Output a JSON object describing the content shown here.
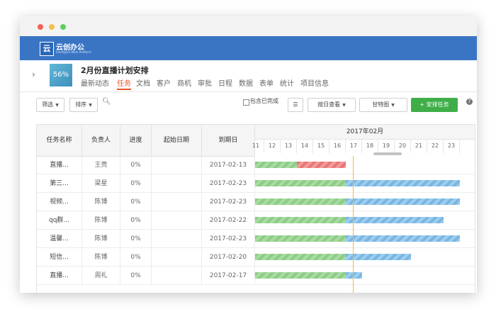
{
  "app": {
    "brand": "云创办公",
    "brand_sub": "Intelligent Work Platform",
    "logo_glyph": "云"
  },
  "project": {
    "title": "2月份直播计划安排",
    "progress": "56%"
  },
  "tabs": [
    {
      "label": "最新动态",
      "active": false
    },
    {
      "label": "任务",
      "active": true
    },
    {
      "label": "文档",
      "active": false
    },
    {
      "label": "客户",
      "active": false
    },
    {
      "label": "商机",
      "active": false
    },
    {
      "label": "审批",
      "active": false
    },
    {
      "label": "日程",
      "active": false
    },
    {
      "label": "数据",
      "active": false
    },
    {
      "label": "表单",
      "active": false
    },
    {
      "label": "统计",
      "active": false
    },
    {
      "label": "项目信息",
      "active": false
    }
  ],
  "toolbar": {
    "filter": "筛选",
    "sort": "排序",
    "include_done": "包含已完成",
    "view_by": "按日查看",
    "chart_type": "甘特图",
    "arrange": "+ 安排任务",
    "help": "?"
  },
  "table": {
    "headers": {
      "name": "任务名称",
      "owner": "负责人",
      "progress": "进度",
      "start": "起始日期",
      "due": "到期日"
    },
    "month": "2017年02月",
    "days": [
      "11",
      "12",
      "13",
      "14",
      "15",
      "16",
      "17",
      "18",
      "19",
      "20",
      "21",
      "22",
      "23"
    ],
    "rows": [
      {
        "name": "直播...",
        "owner": "王亮",
        "progress": "0%",
        "start": "",
        "due": "2017-02-13"
      },
      {
        "name": "第三...",
        "owner": "梁星",
        "progress": "0%",
        "start": "",
        "due": "2017-02-23"
      },
      {
        "name": "视频...",
        "owner": "陈博",
        "progress": "0%",
        "start": "",
        "due": "2017-02-23"
      },
      {
        "name": "qq群...",
        "owner": "陈博",
        "progress": "0%",
        "start": "",
        "due": "2017-02-22"
      },
      {
        "name": "温馨...",
        "owner": "陈博",
        "progress": "0%",
        "start": "",
        "due": "2017-02-23"
      },
      {
        "name": "短信...",
        "owner": "陈博",
        "progress": "0%",
        "start": "",
        "due": "2017-02-20"
      },
      {
        "name": "直播...",
        "owner": "周礼",
        "progress": "0%",
        "start": "",
        "due": "2017-02-17"
      }
    ]
  },
  "gantt": {
    "today": "17",
    "bars": [
      {
        "segments": [
          {
            "from": "11",
            "to": "13",
            "status": "done"
          },
          {
            "from": "14",
            "to": "16",
            "status": "overdue"
          }
        ]
      },
      {
        "segments": [
          {
            "from": "11",
            "to": "16",
            "status": "done"
          },
          {
            "from": "17",
            "to": "23",
            "status": "remaining"
          }
        ]
      },
      {
        "segments": [
          {
            "from": "11",
            "to": "16",
            "status": "done"
          },
          {
            "from": "17",
            "to": "23",
            "status": "remaining"
          }
        ]
      },
      {
        "segments": [
          {
            "from": "11",
            "to": "16",
            "status": "done"
          },
          {
            "from": "17",
            "to": "22",
            "status": "remaining"
          }
        ]
      },
      {
        "segments": [
          {
            "from": "11",
            "to": "16",
            "status": "done"
          },
          {
            "from": "17",
            "to": "23",
            "status": "remaining"
          }
        ]
      },
      {
        "segments": [
          {
            "from": "11",
            "to": "16",
            "status": "done"
          },
          {
            "from": "17",
            "to": "20",
            "status": "remaining"
          }
        ]
      },
      {
        "segments": [
          {
            "from": "11",
            "to": "16",
            "status": "done"
          },
          {
            "from": "17",
            "to": "17",
            "status": "remaining"
          }
        ]
      }
    ]
  },
  "colors": {
    "appbar": "#3a75c4",
    "accent": "#e8552a",
    "primary": "#3fae49",
    "done": "#8ccd86",
    "overdue": "#ea7575",
    "remaining": "#79b7e2",
    "today_line": "#f4b73f"
  }
}
